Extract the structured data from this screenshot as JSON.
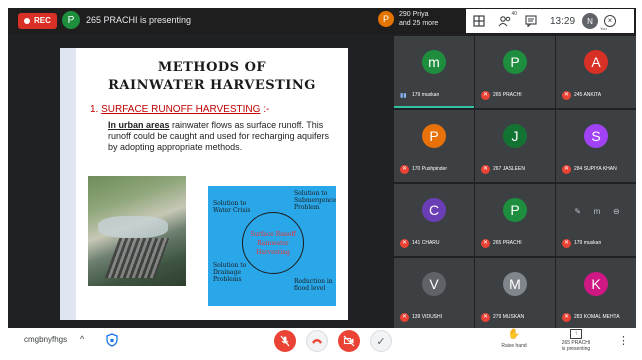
{
  "topbar": {
    "rec_label": "REC",
    "presenter_initial": "P",
    "presenter_text": "265 PRACHI is presenting",
    "others_initial": "P",
    "others_line1": "290 Priya",
    "others_line2": "and 25 more",
    "people_badge": "40",
    "time": "13:29",
    "user_initial": "N",
    "user_label": "You"
  },
  "slide": {
    "title_line1": "METHODS OF",
    "title_line2": "RAINWATER HARVESTING",
    "heading_number": "1.",
    "heading_text": "SURFACE RUNOFF HARVESTING",
    "heading_suffix": ":-",
    "body_emph": "In urban areas",
    "body_rest": " rainwater flows as surface runoff. This runoff could be caught and used for recharging aquifers by adopting appropriate methods.",
    "diagram": {
      "top_left": "Solution to Water Crisis",
      "top_right": "Solution to Submergence Problem",
      "bottom_left": "Solution to Drainage Problems",
      "bottom_right": "Reduction in flood level",
      "center": "Surface Runoff Rainwater Harvesting"
    }
  },
  "participants": [
    {
      "initial": "m",
      "name": "179 muskan",
      "color": "#1e8e3e",
      "state": "speaking"
    },
    {
      "initial": "P",
      "name": "265 PRACHI",
      "color": "#1e8e3e",
      "state": "muted"
    },
    {
      "initial": "A",
      "name": "245 ANKITA",
      "color": "#d93025",
      "state": "muted"
    },
    {
      "initial": "P",
      "name": "170 Pushpinder",
      "color": "#e8710a",
      "state": "muted"
    },
    {
      "initial": "J",
      "name": "267 JASLEEN",
      "color": "#137333",
      "state": "muted"
    },
    {
      "initial": "S",
      "name": "284 SUPIYA KHAN",
      "color": "#a142f4",
      "state": "muted"
    },
    {
      "initial": "C",
      "name": "141 CHARU",
      "color": "#6a3fb5",
      "state": "muted"
    },
    {
      "initial": "P",
      "name": "265 PRACHI",
      "color": "#1e8e3e",
      "state": "muted"
    },
    {
      "initial": "m",
      "name": "179 muskan",
      "color": "#1e8e3e",
      "state": "hover"
    },
    {
      "initial": "V",
      "name": "139 VIDUSHI",
      "color": "#5f6368",
      "state": "muted"
    },
    {
      "initial": "M",
      "name": "279 MUSKAN",
      "color": "#80868b",
      "state": "muted"
    },
    {
      "initial": "K",
      "name": "283 KOMAL MEHTA",
      "color": "#d01884",
      "state": "muted"
    }
  ],
  "bottombar": {
    "meeting_code": "cmgbnyfhgs",
    "raise_hand_label": "Raise hand",
    "present_line1": "265 PRACHI",
    "present_line2": "is presenting"
  },
  "icons": {
    "mic_off": "mic-off-icon",
    "hangup": "phone-hangup-icon",
    "cam_off": "camera-off-icon",
    "check": "check-icon"
  }
}
